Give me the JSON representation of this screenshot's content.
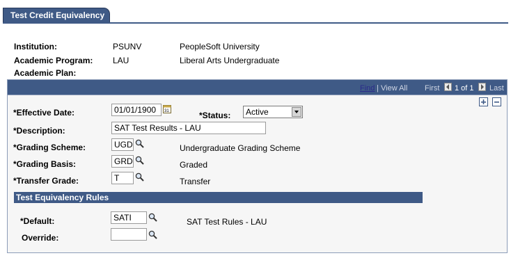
{
  "tab": {
    "label": "Test Credit Equivalency"
  },
  "header": {
    "institution_label": "Institution:",
    "institution_code": "PSUNV",
    "institution_name": "PeopleSoft University",
    "program_label": "Academic Program:",
    "program_code": "LAU",
    "program_name": "Liberal Arts Undergraduate",
    "plan_label": "Academic Plan:"
  },
  "nav": {
    "find": "Find",
    "sep": "|",
    "view_all": "View All",
    "first": "First",
    "count": "1 of 1",
    "last": "Last"
  },
  "form": {
    "effective_date_label": "*Effective Date:",
    "effective_date": "01/01/1900",
    "status_label": "*Status:",
    "status": "Active",
    "description_label": "*Description:",
    "description": "SAT Test Results - LAU",
    "grading_scheme_label": "*Grading Scheme:",
    "grading_scheme": "UGD",
    "grading_scheme_desc": "Undergraduate Grading Scheme",
    "grading_basis_label": "*Grading Basis:",
    "grading_basis": "GRD",
    "grading_basis_desc": "Graded",
    "transfer_grade_label": "*Transfer Grade:",
    "transfer_grade": "T",
    "transfer_grade_desc": "Transfer"
  },
  "rules": {
    "title": "Test Equivalency Rules",
    "default_label": "*Default:",
    "default": "SATI",
    "default_desc": "SAT Test Rules - LAU",
    "override_label": "Override:",
    "override": ""
  },
  "icons": {
    "lookup": "magnifier-icon",
    "calendar": "calendar-icon",
    "add": "plus-icon",
    "delete": "minus-icon",
    "prev": "left-arrow-icon",
    "next": "right-arrow-icon"
  },
  "colors": {
    "accent": "#3f5a86",
    "panel_bg": "#f6f6f6"
  }
}
